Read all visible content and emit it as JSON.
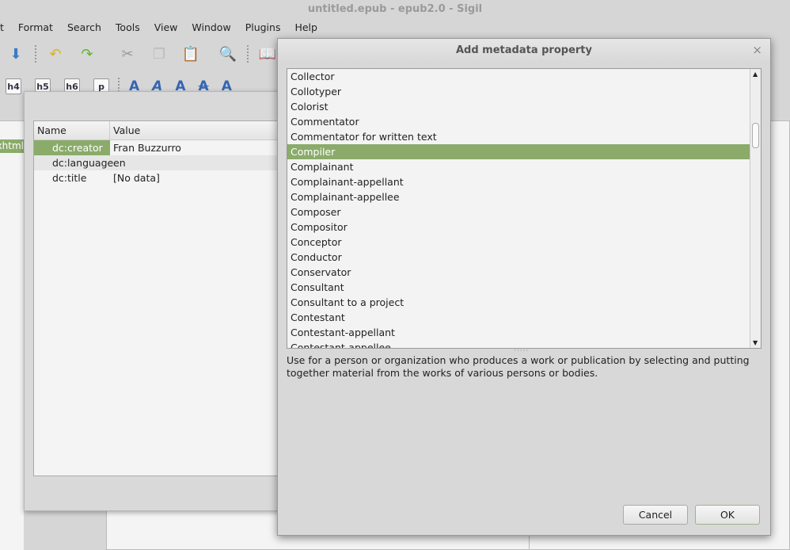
{
  "window": {
    "title": "untitled.epub - epub2.0 - Sigil"
  },
  "menu": [
    "t",
    "Format",
    "Search",
    "Tools",
    "View",
    "Window",
    "Plugins",
    "Help"
  ],
  "toolbar1": [
    "save-icon",
    "undo-icon",
    "redo-icon",
    "cut-icon",
    "copy-icon",
    "paste-icon",
    "find-icon",
    "book-view-icon"
  ],
  "toolbar2": {
    "headings": [
      "h4",
      "h5",
      "h6",
      "p"
    ]
  },
  "left_pane": {
    "selected_item": "xhtml"
  },
  "metadata_editor": {
    "columns": [
      "Name",
      "Value"
    ],
    "rows": [
      {
        "name": "dc:creator",
        "value": "Fran Buzzurro",
        "selected": true
      },
      {
        "name": "dc:language",
        "value": "en"
      },
      {
        "name": "dc:title",
        "value": "[No data]"
      }
    ]
  },
  "add_dialog": {
    "title": "Add metadata property",
    "close": "×",
    "items": [
      "Collector",
      "Collotyper",
      "Colorist",
      "Commentator",
      "Commentator for written text",
      "Compiler",
      "Complainant",
      "Complainant-appellant",
      "Complainant-appellee",
      "Composer",
      "Compositor",
      "Conceptor",
      "Conductor",
      "Conservator",
      "Consultant",
      "Consultant to a project",
      "Contestant",
      "Contestant-appellant",
      "Contestant-appellee"
    ],
    "selected": "Compiler",
    "description": "Use for a person or organization who produces a work or publication by selecting and putting together material from the works of various persons or bodies.",
    "cancel": "Cancel",
    "ok": "OK"
  },
  "colors": {
    "selection": "#8aab6a"
  }
}
